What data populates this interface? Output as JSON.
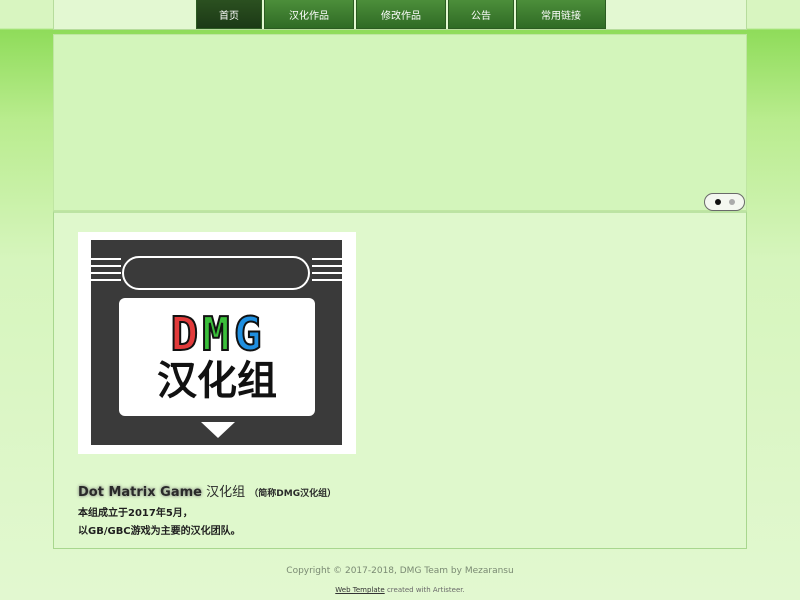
{
  "nav": {
    "items": [
      {
        "label": "首页",
        "active": true
      },
      {
        "label": "汉化作品",
        "active": false
      },
      {
        "label": "修改作品",
        "active": false
      },
      {
        "label": "公告",
        "active": false
      },
      {
        "label": "常用链接",
        "active": false
      }
    ]
  },
  "slider": {
    "total_slides": 2,
    "current_slide": 1
  },
  "logo": {
    "letters": [
      "D",
      "M",
      "G"
    ],
    "letter_colors": [
      "#e23b3b",
      "#3bbf3b",
      "#1f8fe0"
    ],
    "caption": "汉化组"
  },
  "intro": {
    "title_en": "Dot Matrix Game",
    "title_cn": "汉化组",
    "title_note": "（简称DMG汉化组）",
    "line1": "本组成立于2017年5月，",
    "line2": "以GB/GBC游戏为主要的汉化团队。"
  },
  "footer": {
    "copyright": "Copyright © 2017-2018, DMG Team by Mezaransu",
    "template_link": "Web Template",
    "created_with": "created with Artisteer."
  },
  "colors": {
    "nav_bg": "#3d7a2f",
    "nav_active_bg": "#244a1b",
    "content_bg": "#dff8cc"
  }
}
